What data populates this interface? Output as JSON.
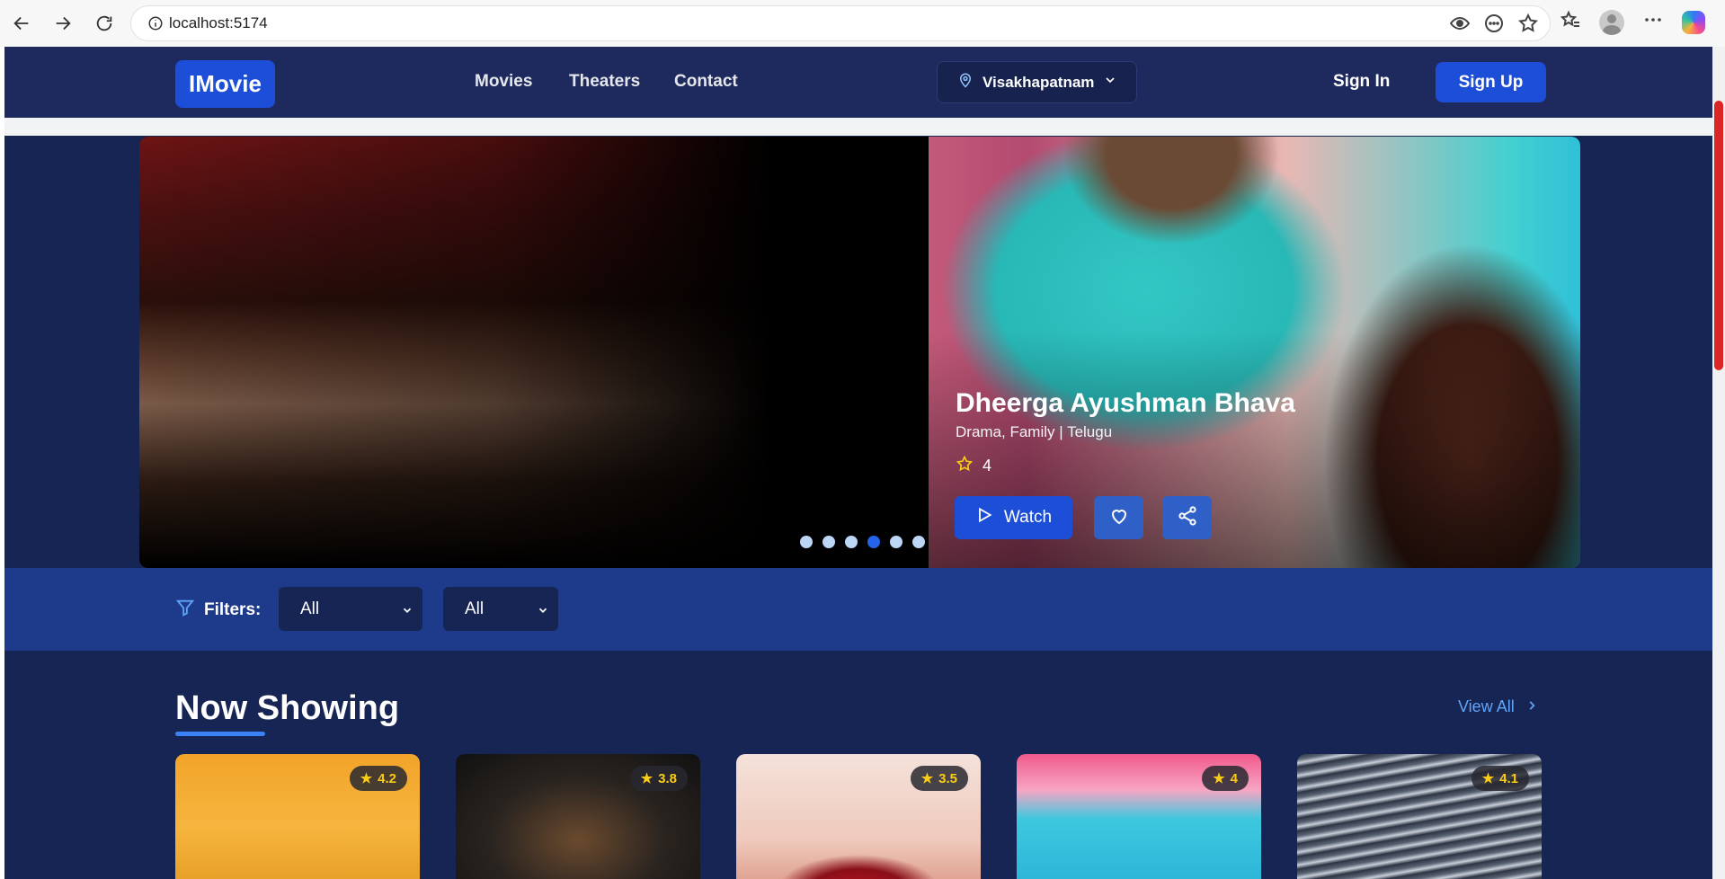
{
  "browser": {
    "url": "localhost:5174"
  },
  "header": {
    "logo": "IMovie",
    "nav": [
      "Movies",
      "Theaters",
      "Contact"
    ],
    "location": "Visakhapatnam",
    "sign_in": "Sign In",
    "sign_up": "Sign Up"
  },
  "hero": {
    "title": "Dheerga Ayushman Bhava",
    "genre": "Drama, Family | Telugu",
    "rating": "4",
    "watch_label": "Watch",
    "slide_count": 6,
    "active_slide": 4
  },
  "filters": {
    "label": "Filters:",
    "select_1": "All",
    "select_2": "All"
  },
  "now_showing": {
    "title": "Now Showing",
    "view_all": "View All",
    "movies": [
      {
        "rating": "4.2"
      },
      {
        "rating": "3.8"
      },
      {
        "rating": "3.5"
      },
      {
        "rating": "4"
      },
      {
        "rating": "4.1"
      }
    ]
  },
  "colors": {
    "page_bg": "#172554",
    "header_bg": "#1e2a5e",
    "accent": "#1d4ed8",
    "filters_bg": "#1e3a8a",
    "link": "#60a5fa",
    "rating_star": "#facc15"
  }
}
